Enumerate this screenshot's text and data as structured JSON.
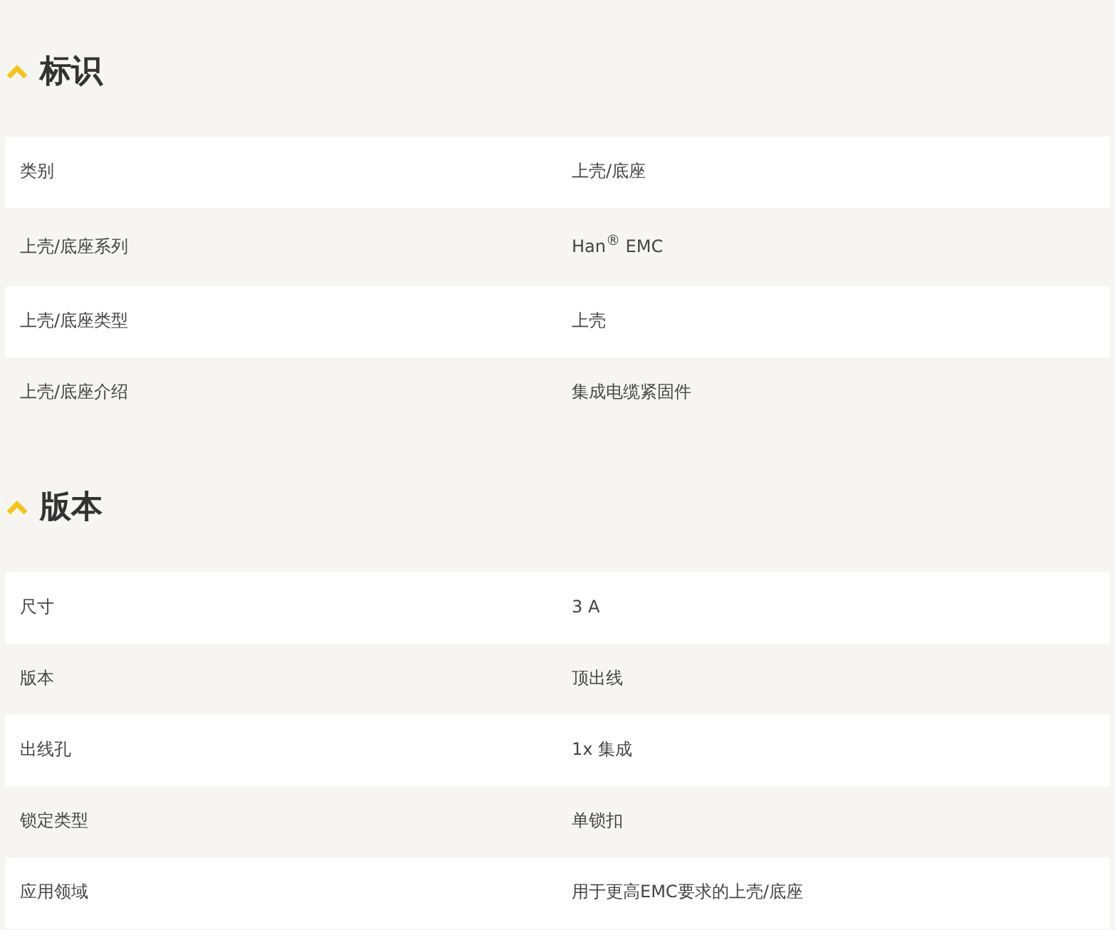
{
  "sections": [
    {
      "title": "标识",
      "expanded": true,
      "rows": [
        {
          "label": "类别",
          "value": "上壳/底座"
        },
        {
          "label": "上壳/底座系列",
          "value": "Han$^{®}$ EMC"
        },
        {
          "label": "上壳/底座类型",
          "value": "上壳"
        },
        {
          "label": "上壳/底座介绍",
          "value": "集成电缆紧固件"
        }
      ]
    },
    {
      "title": "版本",
      "expanded": true,
      "rows": [
        {
          "label": "尺寸",
          "value": "3 A"
        },
        {
          "label": "版本",
          "value": "顶出线"
        },
        {
          "label": "出线孔",
          "value": "1x 集成"
        },
        {
          "label": "锁定类型",
          "value": "单锁扣"
        },
        {
          "label": "应用领域",
          "value": "用于更高EMC要求的上壳/底座"
        }
      ]
    }
  ]
}
